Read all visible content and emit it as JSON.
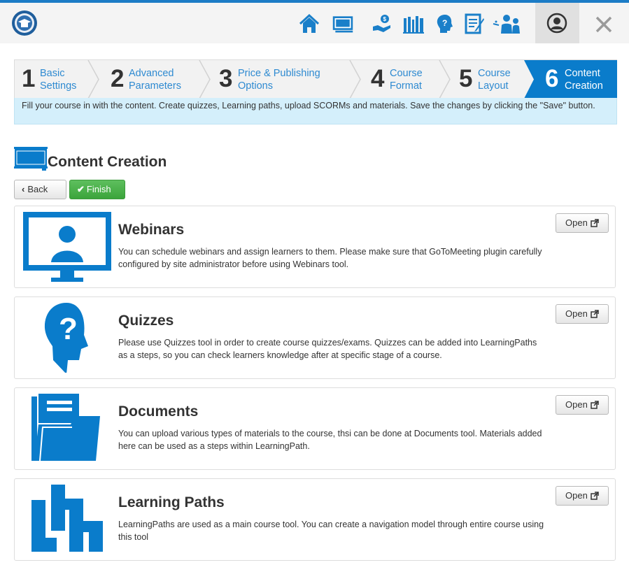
{
  "header": {
    "logo_icon": "course-logo-icon",
    "nav_icons": [
      "home-icon",
      "classroom-icon",
      "hand-coin-icon",
      "library-icon",
      "head-question-icon",
      "document-edit-icon",
      "teacher-learners-icon"
    ],
    "profile_icon": "user-icon",
    "close_icon": "close-icon"
  },
  "wizard": {
    "steps": [
      {
        "number": "1",
        "line1": "Basic",
        "line2": "Settings",
        "active": false
      },
      {
        "number": "2",
        "line1": "Advanced",
        "line2": "Parameters",
        "active": false
      },
      {
        "number": "3",
        "line1": "Price & Publishing",
        "line2": "Options",
        "active": false
      },
      {
        "number": "4",
        "line1": "Course",
        "line2": "Format",
        "active": false
      },
      {
        "number": "5",
        "line1": "Course",
        "line2": "Layout",
        "active": false
      },
      {
        "number": "6",
        "line1": "Content",
        "line2": "Creation",
        "active": true
      }
    ],
    "hint": "Fill your course in with the content. Create quizzes, Learning paths, upload SCORMs and materials. Save the changes by clicking the \"Save\" button."
  },
  "page": {
    "title": "Content Creation",
    "back_label": "Back",
    "finish_label": "Finish"
  },
  "cards": [
    {
      "title": "Webinars",
      "description": "You can schedule webinars and assign learners to them. Please make sure that GoToMeeting plugin carefully configured by site administrator before using Webinars tool.",
      "open_label": "Open",
      "icon": "webinar-monitor-icon"
    },
    {
      "title": "Quizzes",
      "description": "Please use Quizzes tool in order to create course quizzes/exams. Quizzes can be added into LearningPaths as a steps, so you can check learners knowledge after at specific stage of a course.",
      "open_label": "Open",
      "icon": "head-question-icon"
    },
    {
      "title": "Documents",
      "description": "You can upload various types of materials to the course, thsi can be done at Documents tool. Materials added here can be used as a steps within LearningPath.",
      "open_label": "Open",
      "icon": "folder-documents-icon"
    },
    {
      "title": "Learning Paths",
      "description": "LearningPaths are used as a main course tool. You can create a navigation model through entire course using this tool",
      "open_label": "Open",
      "icon": "learning-path-blocks-icon"
    }
  ],
  "colors": {
    "brand_blue": "#0a7ccb",
    "icon_blue": "#1a7fc9",
    "finish_green": "#45a845",
    "hint_bg": "#d4effb"
  }
}
